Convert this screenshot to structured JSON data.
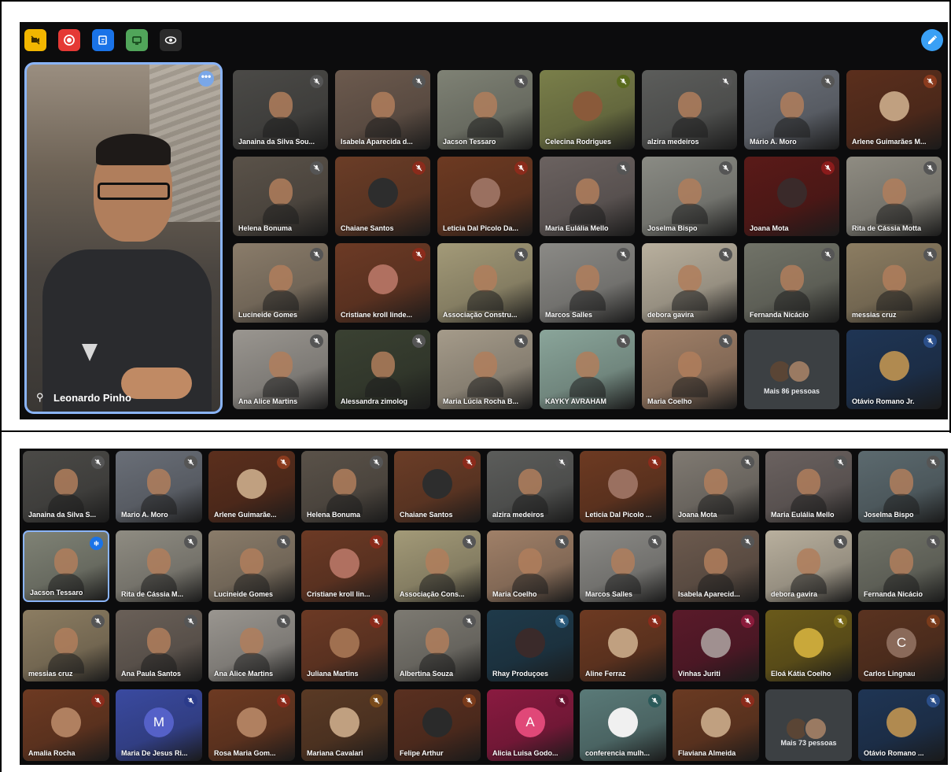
{
  "toolbar": {
    "buttons": [
      {
        "name": "no-camera-button",
        "icon": "camera-off-icon",
        "color": "#f2b600"
      },
      {
        "name": "record-button",
        "icon": "record-icon",
        "color": "#e53935"
      },
      {
        "name": "edit-notes-button",
        "icon": "edit-note-icon",
        "color": "#1a73e8"
      },
      {
        "name": "present-button",
        "icon": "present-icon",
        "color": "#51a55a"
      },
      {
        "name": "view-button",
        "icon": "eye-icon",
        "color": "#2b2b2b"
      }
    ],
    "edit_icon_color": "#3aa0f5"
  },
  "spotlight": {
    "name": "Leonardo Pinho"
  },
  "panel1": {
    "tiles": [
      {
        "name": "Janaina da Silva Sou...",
        "bg": "#4b4a47",
        "mute": "#555"
      },
      {
        "name": "Isabela Aparecida d...",
        "bg": "#6c5a4e",
        "mute": "#555"
      },
      {
        "name": "Jacson Tessaro",
        "bg": "#7f8275",
        "mute": "#555"
      },
      {
        "name": "Celecina Rodrigues",
        "bg": "#7a7f4a",
        "mute": "#5a6b1e",
        "avatar": "#8a5a3a"
      },
      {
        "name": "alzira medeiros",
        "bg": "#5c5d5b",
        "mute": "#555"
      },
      {
        "name": "Mário A. Moro",
        "bg": "#6a6f78",
        "mute": "#555"
      },
      {
        "name": "Arlene Guimarães M...",
        "bg": "#5b2f1d",
        "mute": "#8b3b1e",
        "avatar": "#c0a080"
      },
      {
        "name": "Helena Bonuma",
        "bg": "#5a5249",
        "mute": "#555"
      },
      {
        "name": "Chaiane Santos",
        "bg": "#6b3d27",
        "mute": "#8b2b1b",
        "avatar": "#2d2d2d"
      },
      {
        "name": "Leticia Dal Picolo Da...",
        "bg": "#6d3a22",
        "mute": "#8b2b1b",
        "avatar": "#9a7060"
      },
      {
        "name": "Maria Eulália Mello",
        "bg": "#6b6260",
        "mute": "#555"
      },
      {
        "name": "Joselma Bispo",
        "bg": "#8a8b84",
        "mute": "#555"
      },
      {
        "name": "Joana Mota",
        "bg": "#5a1a18",
        "mute": "#8b1b1b",
        "avatar": "#3a2a2a"
      },
      {
        "name": "Rita de Cássia Motta",
        "bg": "#8f8c82",
        "mute": "#555"
      },
      {
        "name": "Lucineide Gomes",
        "bg": "#8a7c6a",
        "mute": "#555"
      },
      {
        "name": "Cristiane kroll linde...",
        "bg": "#6c3a25",
        "mute": "#8b2b1b",
        "avatar": "#b07060"
      },
      {
        "name": "Associação Constru...",
        "bg": "#a39a78",
        "mute": "#555"
      },
      {
        "name": "Marcos Salles",
        "bg": "#8b8a86",
        "mute": "#555"
      },
      {
        "name": "debora gavira",
        "bg": "#b9b09e",
        "mute": "#555"
      },
      {
        "name": "Fernanda Nicácio",
        "bg": "#717368",
        "mute": "#555"
      },
      {
        "name": "messias cruz",
        "bg": "#8c7d62",
        "mute": "#555"
      },
      {
        "name": "Ana Alice Martins",
        "bg": "#9a9690",
        "mute": "#555"
      },
      {
        "name": "Alessandra zimolog",
        "bg": "#3a4132",
        "mute": "#555"
      },
      {
        "name": "Maria Lúcia Rocha B...",
        "bg": "#a59b8a",
        "mute": "#555"
      },
      {
        "name": "KAYKY AVRAHAM",
        "bg": "#8aa59a",
        "mute": "#555"
      },
      {
        "name": "Maria Coelho",
        "bg": "#a08068",
        "mute": "#555"
      },
      {
        "name": "Mais 86 pessoas",
        "more": true
      },
      {
        "name": "Otávio Romano Jr.",
        "bg": "#1f3554",
        "mute": "#2b4f8a",
        "avatar": "#b08a50"
      }
    ]
  },
  "panel2": {
    "tiles": [
      {
        "name": "Janaina da Silva S...",
        "bg": "#4b4a47",
        "mute": "#555"
      },
      {
        "name": "Mario A. Moro",
        "bg": "#6a6f78",
        "mute": "#555"
      },
      {
        "name": "Arlene Guimarãe...",
        "bg": "#5b2f1d",
        "mute": "#8b3b1e",
        "avatar": "#c0a080"
      },
      {
        "name": "Helena Bonuma",
        "bg": "#5a5249",
        "mute": "#555"
      },
      {
        "name": "Chaiane Santos",
        "bg": "#6b3d27",
        "mute": "#8b2b1b",
        "avatar": "#2d2d2d"
      },
      {
        "name": "alzira medeiros",
        "bg": "#5c5d5b",
        "mute": "#555"
      },
      {
        "name": "Leticia Dal Picolo ...",
        "bg": "#6d3a22",
        "mute": "#8b2b1b",
        "avatar": "#9a7060"
      },
      {
        "name": "Joana Mota",
        "bg": "#807a72",
        "mute": "#555"
      },
      {
        "name": "Maria Eulália Mello",
        "bg": "#6b6260",
        "mute": "#555"
      },
      {
        "name": "Joselma Bispo",
        "bg": "#5c6a6f",
        "mute": "#555"
      },
      {
        "name": "Jacson Tessaro",
        "bg": "#7f8275",
        "mute": "#1a73e8",
        "speaking": true
      },
      {
        "name": "Rita de Cássia M...",
        "bg": "#8f8c82",
        "mute": "#555"
      },
      {
        "name": "Lucineide Gomes",
        "bg": "#8a7c6a",
        "mute": "#555"
      },
      {
        "name": "Cristiane kroll lin...",
        "bg": "#6c3a25",
        "mute": "#8b2b1b",
        "avatar": "#b07060"
      },
      {
        "name": "Associação Cons...",
        "bg": "#a39a78",
        "mute": "#555"
      },
      {
        "name": "Maria Coelho",
        "bg": "#a08068",
        "mute": "#555"
      },
      {
        "name": "Marcos Salles",
        "bg": "#8b8a86",
        "mute": "#555"
      },
      {
        "name": "Isabela Aparecid...",
        "bg": "#6c5a4e",
        "mute": "#555"
      },
      {
        "name": "debora gavira",
        "bg": "#b9b09e",
        "mute": "#555"
      },
      {
        "name": "Fernanda Nicácio",
        "bg": "#717368",
        "mute": "#555"
      },
      {
        "name": "messias cruz",
        "bg": "#8c7d62",
        "mute": "#555"
      },
      {
        "name": "Ana Paula Santos",
        "bg": "#6a6058",
        "mute": "#555"
      },
      {
        "name": "Ana Alice Martins",
        "bg": "#9a9690",
        "mute": "#555"
      },
      {
        "name": "Juliana Martins",
        "bg": "#6c3a25",
        "mute": "#8b2b1b",
        "avatar": "#a07050"
      },
      {
        "name": "Albertina Souza",
        "bg": "#7d7a72",
        "mute": "#555"
      },
      {
        "name": "Rhay Produçoes",
        "bg": "#1f3a4a",
        "mute": "#2b5a7a",
        "avatar": "#3a2a2a"
      },
      {
        "name": "Aline Ferraz",
        "bg": "#6d3a22",
        "mute": "#8b2b1b",
        "avatar": "#c0a080"
      },
      {
        "name": "Vinhas Juriti",
        "bg": "#5a1a2a",
        "mute": "#8b1b3b",
        "avatar": "#a09090"
      },
      {
        "name": "Eloá Kátia Coelho",
        "bg": "#6a5a1a",
        "mute": "#7a6a1b",
        "avatar": "#c9a83a"
      },
      {
        "name": "Carlos Lingnau",
        "bg": "#5a3320",
        "mute": "#7a3b1b",
        "avatar": "#8a6a5a",
        "letter": "C"
      },
      {
        "name": "Amalia Rocha",
        "bg": "#6d3a22",
        "mute": "#8b2b1b",
        "avatar": "#b08060"
      },
      {
        "name": "Maria De Jesus Ri...",
        "bg": "#3a4aa0",
        "mute": "#2b3b8a",
        "avatar": "#5561c8",
        "letter": "M"
      },
      {
        "name": "Rosa Maria Gom...",
        "bg": "#6d3a22",
        "mute": "#8b2b1b",
        "avatar": "#b08060"
      },
      {
        "name": "Mariana Cavalari",
        "bg": "#5a3a25",
        "mute": "#7a4b1b",
        "avatar": "#c0a080"
      },
      {
        "name": "Felipe Arthur",
        "bg": "#5a3020",
        "mute": "#7a3b1b",
        "avatar": "#2a2a2a"
      },
      {
        "name": "Alicia Luisa Godo...",
        "bg": "#8a1a40",
        "mute": "#6a1230",
        "avatar": "#e04878",
        "letter": "A"
      },
      {
        "name": "conferencia mulh...",
        "bg": "#5a7a78",
        "mute": "#2b5a5a",
        "avatar": "#f0f0f0"
      },
      {
        "name": "Flaviana Almeida",
        "bg": "#6a3a22",
        "mute": "#8b2b1b",
        "avatar": "#c0a080"
      },
      {
        "name": "Mais 73 pessoas",
        "more": true
      },
      {
        "name": "Otávio Romano ...",
        "bg": "#1f3554",
        "mute": "#2b4f8a",
        "avatar": "#b08a50"
      }
    ]
  }
}
